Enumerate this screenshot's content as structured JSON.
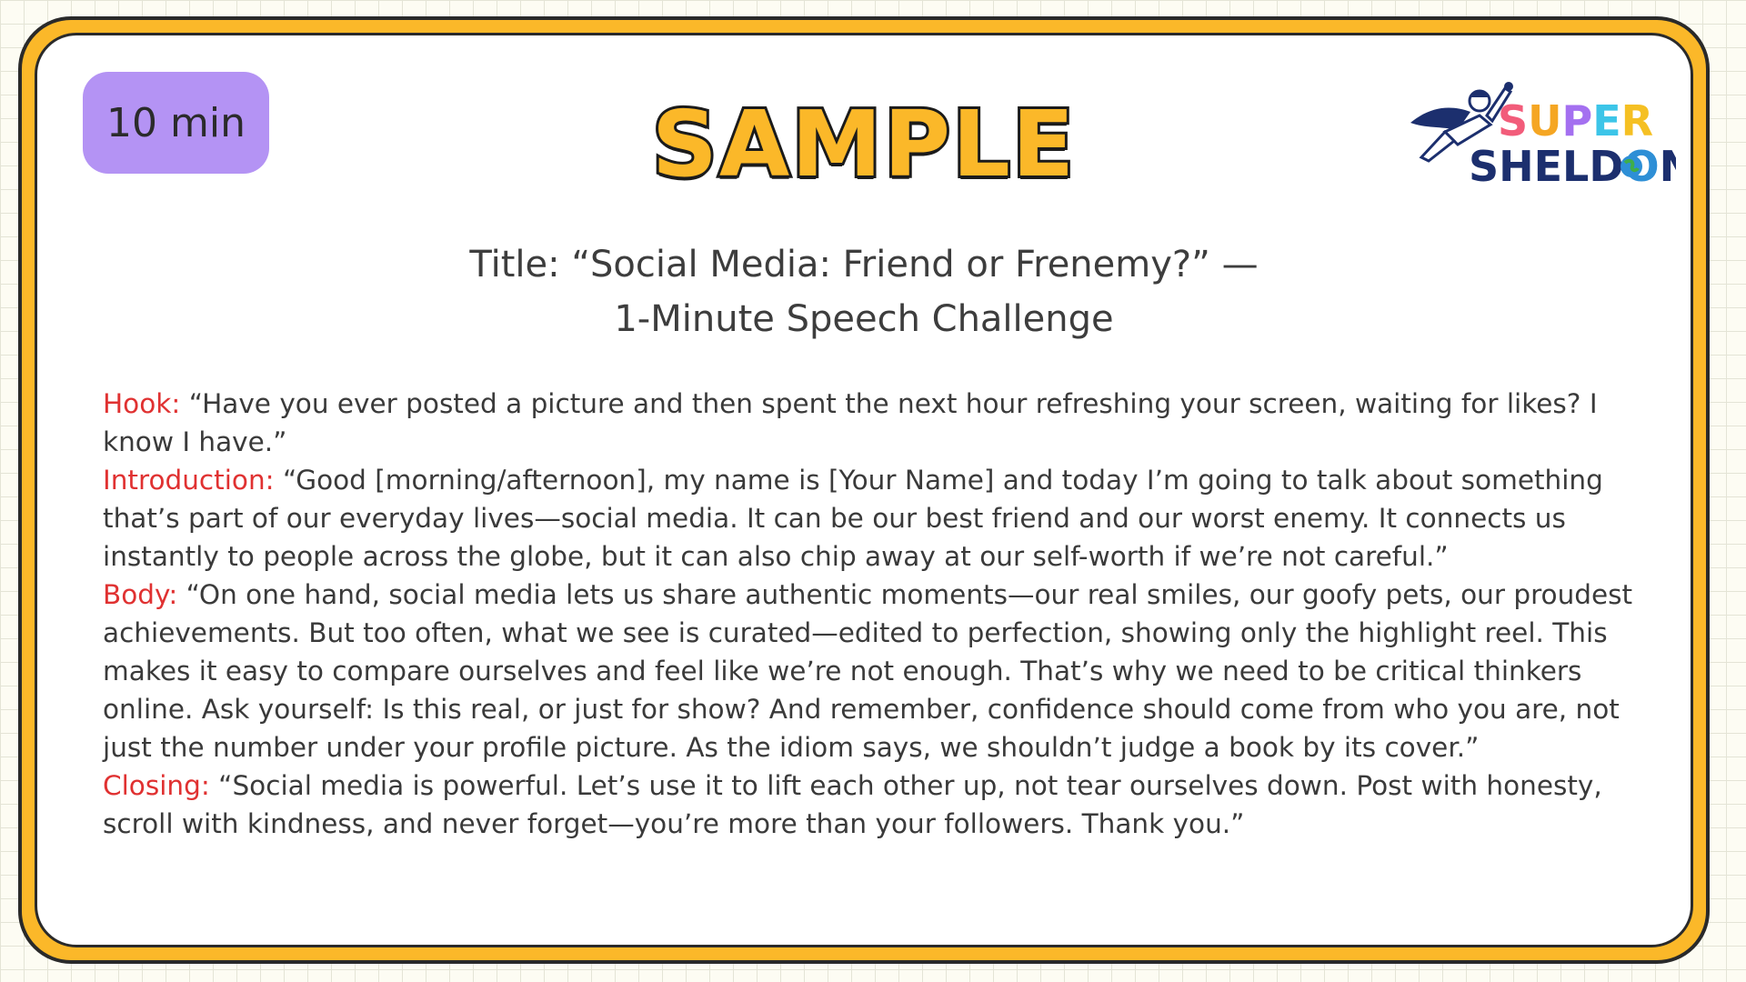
{
  "badge": {
    "text": "10 min"
  },
  "header": {
    "sample_label": "SAMPLE"
  },
  "logo": {
    "line1": "SUPER",
    "line2": "SHELDON"
  },
  "title": {
    "line1": "Title: “Social Media: Friend or Frenemy?” —",
    "line2": "1-Minute Speech Challenge"
  },
  "sections": [
    {
      "label": "Hook:",
      "text": "“Have you ever posted a picture and then spent the next hour refreshing your screen, waiting for likes? I know I have.”"
    },
    {
      "label": "Introduction:",
      "text": "“Good [morning/afternoon], my name is [Your Name] and today I’m going to talk about something that’s part of our everyday lives—social media. It can be our best friend and our worst enemy. It connects us instantly to people across the globe, but it can also chip away at our self-worth if we’re not careful.”"
    },
    {
      "label": "Body:",
      "text": "“On one hand, social media lets us share authentic moments—our real smiles, our goofy pets, our proudest achievements. But too often, what we see is curated—edited to perfection, showing only the highlight reel. This makes it easy to compare ourselves and feel like we’re not enough. That’s why we need to be critical thinkers online. Ask yourself: Is this real, or just for show? And remember, confidence should come from who you are, not just the number under your profile picture. As the idiom says, we shouldn’t judge a book by its cover.”"
    },
    {
      "label": "Closing:",
      "text": "“Social media is powerful. Let’s use it to lift each other up, not tear ourselves down. Post with honesty, scroll with kindness, and never forget—you’re more than your followers. Thank you.”"
    }
  ],
  "colors": {
    "frame": "#fbb829",
    "badge": "#b493f4",
    "label_red": "#e03131",
    "logo_navy": "#1c2f6e"
  }
}
